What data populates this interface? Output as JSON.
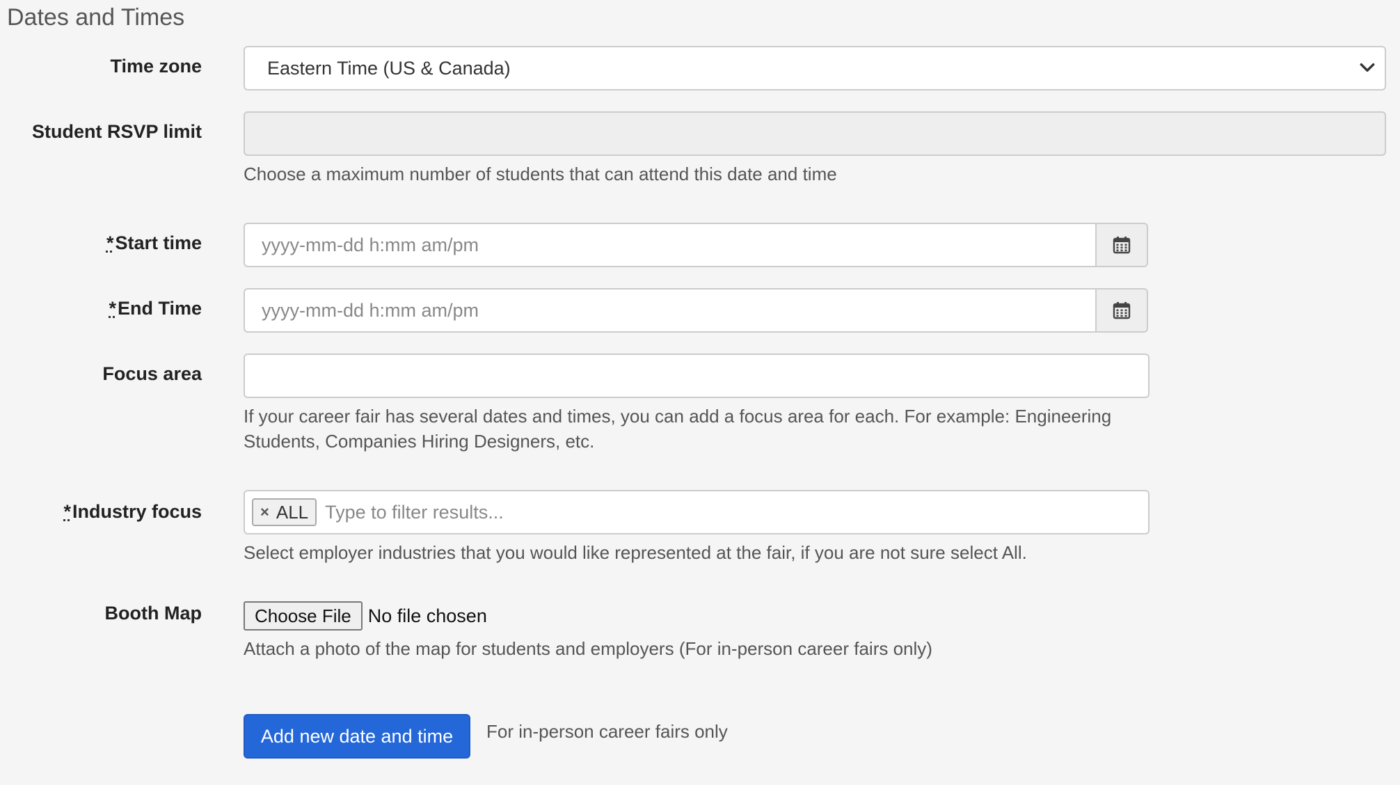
{
  "section": {
    "title": "Dates and Times"
  },
  "timezone": {
    "label": "Time zone",
    "value": "Eastern Time (US & Canada)"
  },
  "rsvp": {
    "label": "Student RSVP limit",
    "value": "",
    "help": "Choose a maximum number of students that can attend this date and time"
  },
  "start_time": {
    "required_mark": "*",
    "label": "Start time",
    "placeholder": "yyyy-mm-dd h:mm am/pm"
  },
  "end_time": {
    "required_mark": "*",
    "label": "End Time",
    "placeholder": "yyyy-mm-dd h:mm am/pm"
  },
  "focus_area": {
    "label": "Focus area",
    "value": "",
    "help": "If your career fair has several dates and times, you can add a focus area for each. For example: Engineering Students, Companies Hiring Designers, etc."
  },
  "industry_focus": {
    "required_mark": "*",
    "label": "Industry focus",
    "tags": [
      "ALL"
    ],
    "tag_remove_glyph": "×",
    "placeholder": "Type to filter results...",
    "help": "Select employer industries that you would like represented at the fair, if you are not sure select All."
  },
  "booth_map": {
    "label": "Booth Map",
    "button_label": "Choose File",
    "file_status": "No file chosen",
    "help": "Attach a photo of the map for students and employers (For in-person career fairs only)"
  },
  "actions": {
    "add_button_label": "Add new date and time",
    "note": "For in-person career fairs only"
  },
  "icons": {
    "select_arrow": "chevron-down-icon",
    "calendar": "calendar-icon",
    "remove_tag": "close-icon"
  },
  "colors": {
    "primary_button": "#2467d8",
    "background": "#f5f5f5"
  }
}
